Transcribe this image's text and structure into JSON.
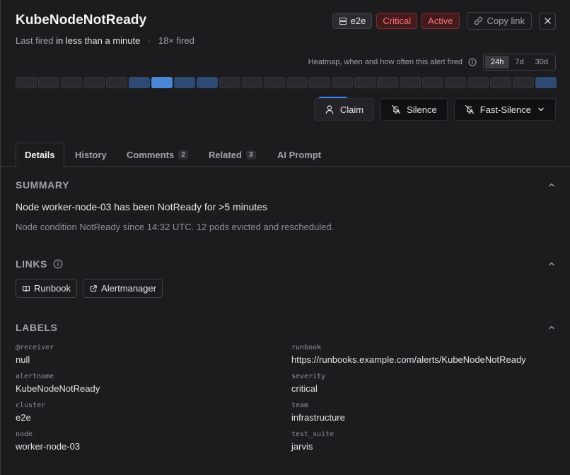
{
  "header": {
    "title": "KubeNodeNotReady",
    "last_fired_prefix": "Last fired",
    "last_fired_value": "in less than a minute",
    "separator": "·",
    "fired_count": "18× fired",
    "env_chip": "e2e",
    "severity_chip": "Critical",
    "status_chip": "Active",
    "copy_link_label": "Copy link",
    "colors": {
      "critical": "#f87171",
      "critical_bg": "#451a1d"
    }
  },
  "heatmap": {
    "caption": "Heatmap, when and how often this alert fired",
    "ranges": [
      "24h",
      "7d",
      "30d"
    ],
    "selected_range": "24h",
    "levels": [
      0,
      0,
      0,
      0,
      0,
      1,
      2,
      1,
      1,
      0,
      0,
      0,
      0,
      0,
      0,
      0,
      0,
      0,
      0,
      0,
      0,
      0,
      0,
      1
    ],
    "colors": {
      "empty": "#2a2a2f",
      "level1": "#2f4a72",
      "level2": "#4a86d6"
    }
  },
  "actions": {
    "claim": "Claim",
    "silence": "Silence",
    "fast_silence": "Fast-Silence"
  },
  "tabs": [
    {
      "label": "Details",
      "count": null
    },
    {
      "label": "History",
      "count": null
    },
    {
      "label": "Comments",
      "count": "2"
    },
    {
      "label": "Related",
      "count": "3"
    },
    {
      "label": "AI Prompt",
      "count": null
    }
  ],
  "summary": {
    "heading": "SUMMARY",
    "main": "Node worker-node-03 has been NotReady for >5 minutes",
    "detail": "Node condition NotReady since 14:32 UTC. 12 pods evicted and rescheduled."
  },
  "links": {
    "heading": "LINKS",
    "items": [
      "Runbook",
      "Alertmanager"
    ]
  },
  "labels": {
    "heading": "LABELS",
    "items": [
      {
        "key": "@receiver",
        "value": "null"
      },
      {
        "key": "runbook",
        "value": "https://runbooks.example.com/alerts/KubeNodeNotReady"
      },
      {
        "key": "alertname",
        "value": "KubeNodeNotReady"
      },
      {
        "key": "severity",
        "value": "critical"
      },
      {
        "key": "cluster",
        "value": "e2e"
      },
      {
        "key": "team",
        "value": "infrastructure"
      },
      {
        "key": "node",
        "value": "worker-node-03"
      },
      {
        "key": "test_suite",
        "value": "jarvis"
      }
    ]
  }
}
